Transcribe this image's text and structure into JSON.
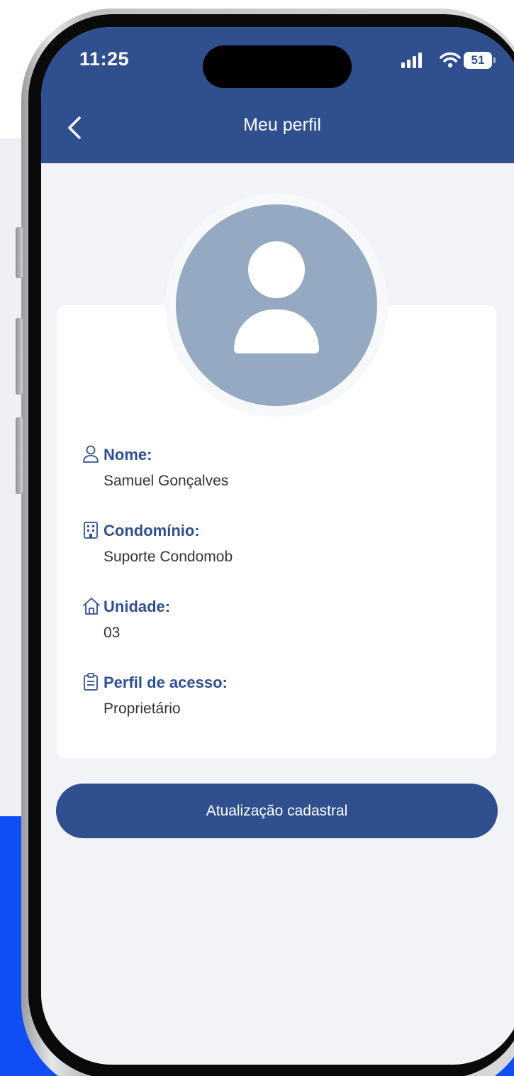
{
  "status_bar": {
    "time": "11:25",
    "battery": "51",
    "signal_icon": "signal-bars-icon",
    "wifi_icon": "wifi-icon"
  },
  "header": {
    "title": "Meu perfil",
    "back_icon": "chevron-left-icon"
  },
  "profile": {
    "avatar_icon": "user-avatar-icon",
    "fields": [
      {
        "icon": "person-icon",
        "label": "Nome:",
        "value": "Samuel Gonçalves"
      },
      {
        "icon": "building-icon",
        "label": "Condomínio:",
        "value": "Suporte Condomob"
      },
      {
        "icon": "home-icon",
        "label": "Unidade:",
        "value": "03"
      },
      {
        "icon": "clipboard-icon",
        "label": "Perfil de acesso:",
        "value": "Proprietário"
      }
    ]
  },
  "actions": {
    "update_label": "Atualização cadastral"
  },
  "colors": {
    "brand": "#2f4f8f",
    "avatar": "#96a9c2",
    "screen_background": "#f2f3f6",
    "page_accent": "#0f4df5"
  }
}
